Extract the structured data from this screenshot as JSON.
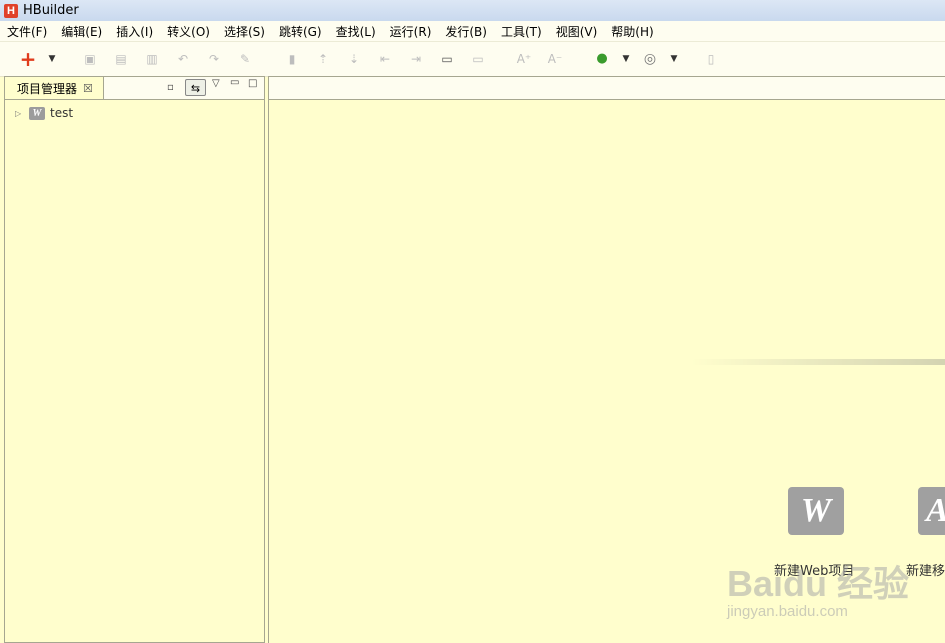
{
  "window": {
    "logo_letter": "H",
    "title": "HBuilder"
  },
  "menu": [
    "文件(F)",
    "编辑(E)",
    "插入(I)",
    "转义(O)",
    "选择(S)",
    "跳转(G)",
    "查找(L)",
    "运行(R)",
    "发行(B)",
    "工具(T)",
    "视图(V)",
    "帮助(H)"
  ],
  "toolbar": {
    "new_icon": "+",
    "dropdown_icon": "▼",
    "icons": {
      "save": "▣",
      "save_all": "▤",
      "save_as": "▥",
      "undo": "↶",
      "redo": "↷",
      "format": "✎",
      "bookmark": "▮",
      "prev": "⇡",
      "next": "⇣",
      "jump_start": "⇤",
      "jump_end": "⇥",
      "comment": "▭",
      "uncomment": "▭",
      "font_inc": "A⁺",
      "font_dec": "A⁻",
      "run": "●",
      "browser": "◎",
      "help": "▯"
    }
  },
  "project_panel": {
    "tab_label": "项目管理器",
    "close_icon": "☒",
    "collapse_icon": "▫",
    "link_icon": "⇆",
    "menu_icon": "▽",
    "min_icon": "▭",
    "max_icon": "□",
    "tree": [
      {
        "label": "test",
        "icon_letter": "W",
        "expander": "▷"
      }
    ]
  },
  "welcome": {
    "cards": [
      {
        "icon_letter": "W",
        "label": "新建Web项目"
      },
      {
        "icon_letter": "A",
        "label": "新建移"
      }
    ]
  },
  "watermark": {
    "logo": "Baidu 经验",
    "url": "jingyan.baidu.com"
  }
}
